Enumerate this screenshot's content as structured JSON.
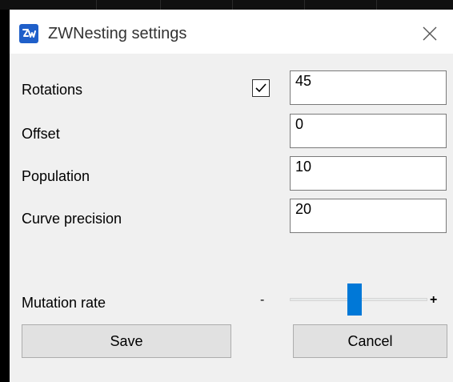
{
  "window": {
    "title": "ZWNesting settings",
    "app_icon": "zwnesting-app-icon",
    "close_icon": "close-icon"
  },
  "fields": {
    "rotations": {
      "label": "Rotations",
      "value": "45",
      "checked": true
    },
    "offset": {
      "label": "Offset",
      "value": "0"
    },
    "population": {
      "label": "Population",
      "value": "10"
    },
    "curve_precision": {
      "label": "Curve precision",
      "value": "20"
    }
  },
  "mutation": {
    "label": "Mutation rate",
    "min_symbol": "-",
    "max_symbol": "+",
    "level": 0.47
  },
  "buttons": {
    "save": "Save",
    "cancel": "Cancel"
  },
  "colors": {
    "accent": "#0078d7",
    "app_icon_bg": "#1f5fc9",
    "window_bg": "#f0f0f0",
    "titlebar_bg": "#ffffff"
  }
}
